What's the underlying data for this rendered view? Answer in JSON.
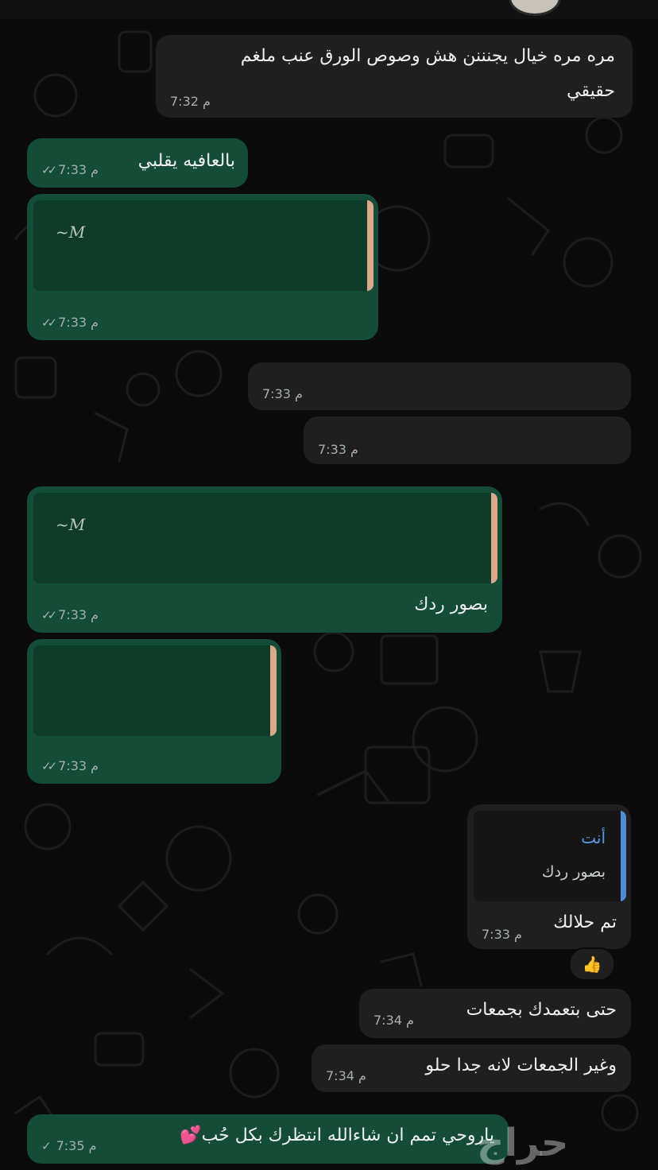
{
  "chat": {
    "messages": [
      {
        "id": "m1",
        "text_line1": "مره مره خيال يجنننن هش وصوص الورق عنب ملغم",
        "text_line2": "حقيقي",
        "time": "7:32 م"
      },
      {
        "id": "m2",
        "text": "بالعافيه يقلبي",
        "time": "7:33 م"
      },
      {
        "id": "m3",
        "quote_author": "~M",
        "time": "7:33 م"
      },
      {
        "id": "m4",
        "time": "7:33 م"
      },
      {
        "id": "m5",
        "time": "7:33 م"
      },
      {
        "id": "m6",
        "quote_author": "~M",
        "text": "بصور ردك",
        "time": "7:33 م"
      },
      {
        "id": "m7",
        "time": "7:33 م"
      },
      {
        "id": "m8",
        "reply_author": "أنت",
        "reply_text": "بصور ردك",
        "text": "تم حلالك",
        "time": "7:33 م",
        "reaction": "👍"
      },
      {
        "id": "m9",
        "text": "حتى بتعمدك بجمعات",
        "time": "7:34 م"
      },
      {
        "id": "m10",
        "text": "وغير الجمعات لانه جدا حلو",
        "time": "7:34 م"
      },
      {
        "id": "m11",
        "text": "ياروحي تمم ان شاءالله  انتظرك بكل حُب💕",
        "time": "7:35 م"
      }
    ]
  },
  "watermark": "حراج",
  "colors": {
    "incoming_bubble": "#1f1f1f",
    "outgoing_bubble": "#134d37",
    "background": "#0b0b0b",
    "quote_bar": "#d9a98a",
    "reply_bar": "#4f8ad8"
  }
}
